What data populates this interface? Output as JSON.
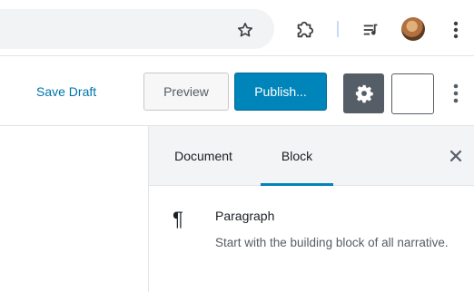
{
  "browser": {
    "icons": [
      "star-icon",
      "extension-icon",
      "media-queue-icon",
      "avatar",
      "kebab-menu-icon"
    ]
  },
  "header": {
    "save_draft_label": "Save Draft",
    "preview_label": "Preview",
    "publish_label": "Publish...",
    "accent_color": "#0085ba",
    "link_color": "#0073aa"
  },
  "sidebar": {
    "tabs": [
      {
        "label": "Document",
        "active": false
      },
      {
        "label": "Block",
        "active": true
      }
    ],
    "close_glyph": "×",
    "block": {
      "icon": "paragraph-icon",
      "icon_glyph": "¶",
      "title": "Paragraph",
      "description": "Start with the building block of all narrative."
    }
  }
}
